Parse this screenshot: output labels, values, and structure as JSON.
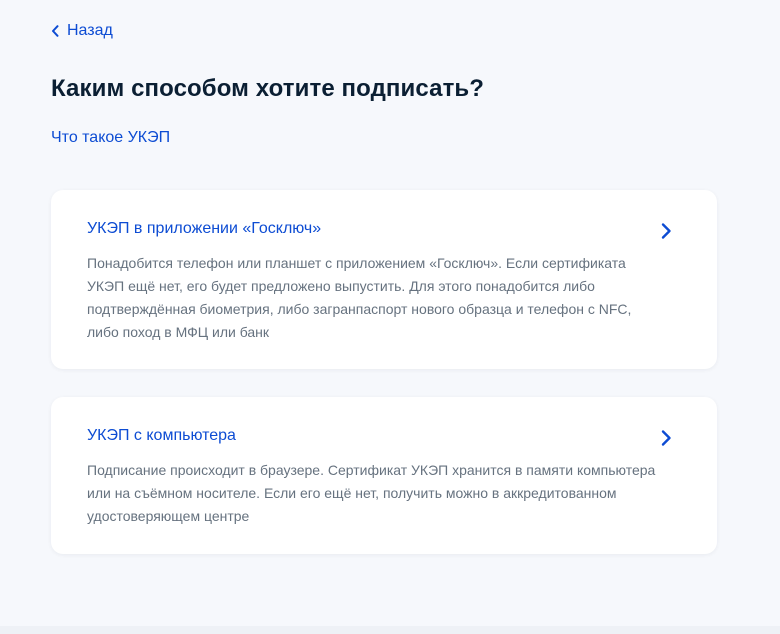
{
  "nav": {
    "back_label": "Назад"
  },
  "page": {
    "title": "Каким способом хотите подписать?",
    "info_link": "Что такое УКЭП"
  },
  "options": [
    {
      "title": "УКЭП в приложении «Госключ»",
      "description": "Понадобится телефон или планшет с приложением «Госключ». Если сертификата УКЭП ещё нет, его будет предложено выпустить. Для этого понадобится либо подтверждённая биометрия, либо загранпаспорт нового образца и телефон с NFC, либо поход в МФЦ или банк",
      "icon": "chevron-right-icon"
    },
    {
      "title": "УКЭП с компьютера",
      "description": "Подписание происходит в браузере. Сертификат УКЭП хранится в памяти компьютера или на съёмном носителе. Если его ещё нет, получить можно в аккредитованном удостоверяющем центре",
      "icon": "chevron-right-icon"
    }
  ],
  "colors": {
    "link": "#0d4cd3",
    "text": "#0b1f33",
    "muted": "#66727f",
    "background": "#f6f8fc",
    "card": "#ffffff"
  }
}
